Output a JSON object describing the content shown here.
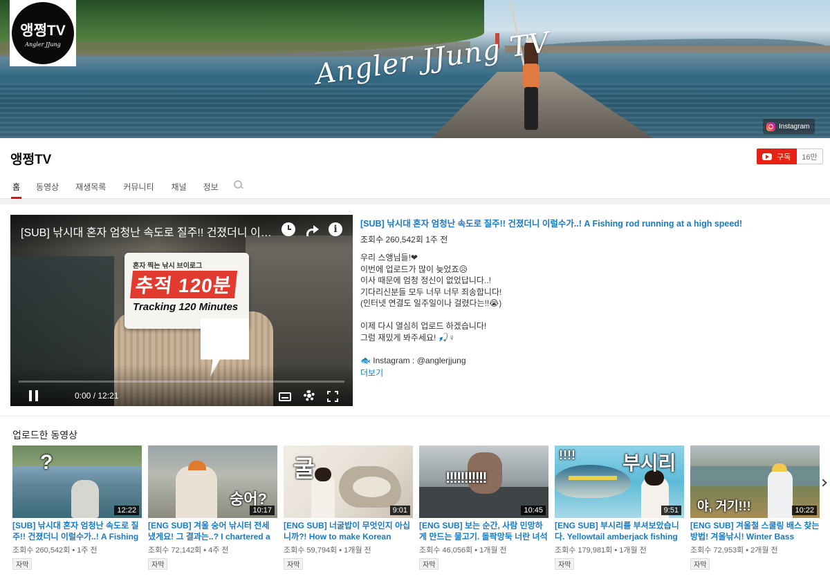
{
  "banner": {
    "title": "Angler JJung TV",
    "logo_main": "앵쩡TV",
    "logo_sub": "Angler JJung",
    "instagram_label": "Instagram"
  },
  "channel": {
    "name": "앵쩡TV",
    "subscribe_label": "구독",
    "subscriber_count": "16만"
  },
  "tabs": [
    "홈",
    "동영상",
    "재생목록",
    "커뮤니티",
    "채널",
    "정보"
  ],
  "featured": {
    "player_title": "[SUB] 낚시대 혼자 엄청난 속도로 질주!! 건졌더니 이럴수가..! A Fishing rod running at a high speed!",
    "thumb_top": "혼자 찍는 낚시 브이로그",
    "thumb_big": "추적 120분",
    "thumb_en": "Tracking 120 Minutes",
    "time": "0:00 / 12:21",
    "title": "[SUB] 낚시대 혼자 엄청난 속도로 질주!! 건졌더니 이럴수가..! A Fishing rod running at a high speed!",
    "meta": "조회수 260,542회 1주 전",
    "desc_lines": [
      "우리 스앵님들!❤",
      "이번에 업로드가 많이 늦었죠😥",
      "이사 때문에 엄청 정신이 없었답니다..!",
      "기다리신분들 모두 너무 너무 죄송합니다!",
      "(인터넷 연결도 일주일이나 걸렸다는!!😭)",
      "",
      "이제 다시 열심히 업로드 하겠습니다!",
      "그럼 재밌게 봐주세요! 🎣♀",
      "",
      "🐟 Instagram : @anglerjjung"
    ],
    "more_label": "더보기"
  },
  "uploads": {
    "heading": "업로드한 동영상",
    "badge": "자막",
    "videos": [
      {
        "title": "[SUB] 낚시대 혼자 엄청난 속도로 질주!! 건졌더니 이럴수가..! A Fishing rod running at a high speed!",
        "meta": "조회수 260,542회 • 1주 전",
        "duration": "12:22",
        "overlay": "?"
      },
      {
        "title": "[ENG SUB] 겨울 숭어 낚시터 전세 냈게요! 그 결과는..? I chartered a fishing spot",
        "meta": "조회수 72,142회 • 4주 전",
        "duration": "10:17",
        "overlay": "숭어?"
      },
      {
        "title": "[ENG SUB] 너굴밥이 무엇인지 아십니까?! How to make Korean oyster rice",
        "meta": "조회수 59,794회 • 1개월 전",
        "duration": "9:01",
        "overlay": "굴"
      },
      {
        "title": "[ENG SUB] 보는 순간, 사람 민망하게 만드는 물고기. 돌팍망둑 너란 녀석",
        "meta": "조회수 46,056회 • 1개월 전",
        "duration": "10:45",
        "overlay": "!!!!!!!!!!!"
      },
      {
        "title": "[ENG SUB] 부시리를 부셔보았습니다. Yellowtail amberjack fishing",
        "meta": "조회수 179,981회 • 1개월 전",
        "duration": "9:51",
        "overlay": "부시리"
      },
      {
        "title": "[ENG SUB] 겨울철 스쿨링 배스 찾는 방법! 겨울낚시! Winter Bass Fishing",
        "meta": "조회수 72,953회 • 2개월 전",
        "duration": "10:22",
        "overlay": "야, 거기!!!"
      }
    ]
  },
  "colors": {
    "accent": "#cc181e",
    "link": "#167ac6",
    "subscribe": "#e62117"
  },
  "icons": [
    "instagram-icon",
    "youtube-play-icon",
    "search-icon",
    "watch-later-icon",
    "share-icon",
    "info-icon",
    "pause-icon",
    "captions-icon",
    "settings-icon",
    "fullscreen-icon",
    "next-arrow-icon"
  ]
}
